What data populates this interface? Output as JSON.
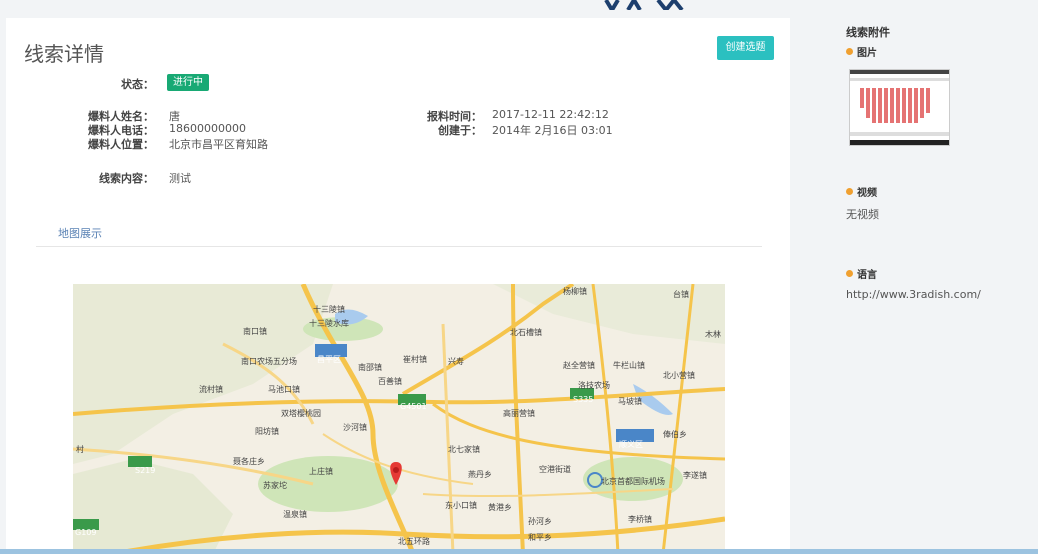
{
  "page": {
    "title": "线索详情",
    "create_button": "创建选题"
  },
  "details": {
    "status_label": "状态：",
    "status_value": "进行中",
    "name_label": "爆料人姓名：",
    "name_value": "唐",
    "phone_label": "爆料人电话：",
    "phone_value": "18600000000",
    "location_label": "爆料人位置：",
    "location_value": "北京市昌平区育知路",
    "report_time_label": "报料时间：",
    "report_time_value": "2017-12-11 22:42:12",
    "created_label": "创建于：",
    "created_value": "2014年 2月16日 03:01",
    "content_label": "线索内容：",
    "content_value": "测试"
  },
  "map_section": {
    "tab_label": "地图展示",
    "place_labels": [
      "十三陵镇",
      "十三陵水库",
      "南口镇",
      "南口农场五分场",
      "昌平区",
      "南邵镇",
      "崔村镇",
      "兴寿",
      "百善镇",
      "流村镇",
      "马池口镇",
      "G4501",
      "双塔樱桃园",
      "沙河镇",
      "阳坊镇",
      "北七家镇",
      "高丽营镇",
      "赵全营镇",
      "牛栏山镇",
      "北小营镇",
      "洛技农场",
      "马坡镇",
      "顺义区",
      "俸伯乡",
      "苏家坨",
      "上庄镇",
      "空港街道",
      "北京首都国际机场",
      "李遂镇",
      "李桥镇",
      "温泉镇",
      "东小口镇",
      "黄港乡",
      "孙河乡",
      "和平乡",
      "北五环路",
      "S219",
      "G109",
      "S335",
      "木林",
      "北石槽镇",
      "杨柳镇",
      "聂各庄乡",
      "燕丹乡",
      "村",
      "台镇"
    ]
  },
  "sidebar": {
    "title": "线索附件",
    "images_label": "图片",
    "video_label": "视频",
    "video_value": "无视频",
    "voice_label": "语言",
    "voice_value": "http://www.3radish.com/"
  },
  "colors": {
    "accent": "#2bc0c0",
    "status_green": "#18a974",
    "dot_orange": "#f0a030",
    "map_marker": "#e53935"
  }
}
